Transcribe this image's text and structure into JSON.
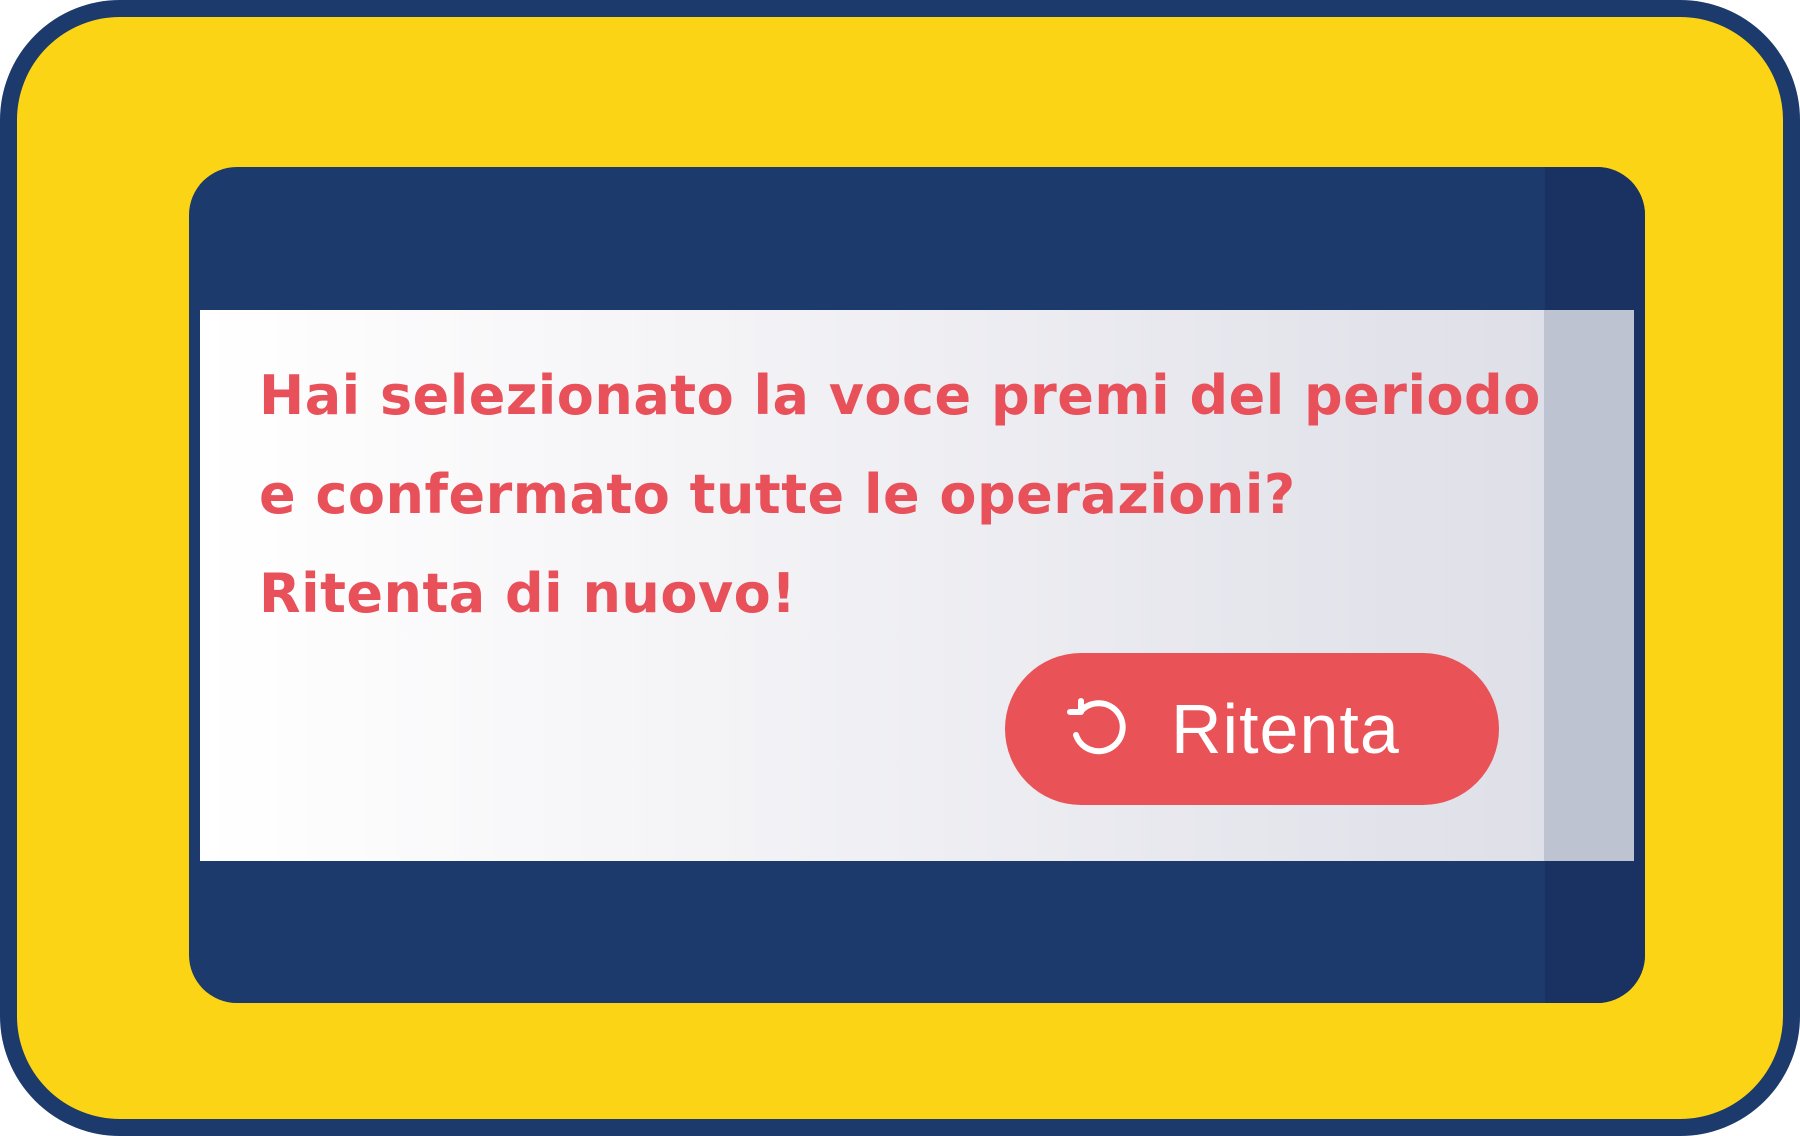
{
  "dialog": {
    "message_lines": [
      "Hai selezionato la voce premi del periodo",
      "e confermato tutte le operazioni?",
      "Ritenta di nuovo!"
    ],
    "retry_button": {
      "label": "Ritenta",
      "icon": "retry-icon"
    }
  },
  "colors": {
    "frame": "#FBD515",
    "border": "#1C3A6B",
    "text": "#E8505A",
    "button": "#E95257"
  }
}
